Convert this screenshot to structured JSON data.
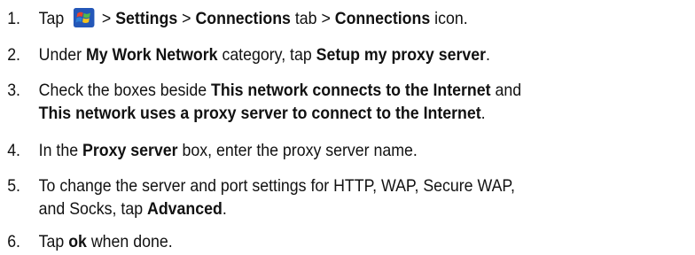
{
  "steps": [
    {
      "num": "1.",
      "tap": "Tap ",
      "gt1": " > ",
      "settings": "Settings",
      "gt2": " > ",
      "connections_tab": "Connections",
      "tab_word": " tab > ",
      "connections_icon": "Connections",
      "icon_word": " icon."
    },
    {
      "num": "2.",
      "under": "Under ",
      "network": "My Work Network",
      "category": " category, tap ",
      "setup": "Setup my proxy server",
      "end": "."
    },
    {
      "num": "3.",
      "check": "Check the boxes beside ",
      "connects": "This network connects to the Internet",
      "and": " and",
      "uses": "This network uses a proxy server to connect to the Internet",
      "end": "."
    },
    {
      "num": "4.",
      "in": "In the ",
      "proxy": "Proxy server",
      "rest": " box, enter the proxy server name."
    },
    {
      "num": "5.",
      "line1": "To change the server and port settings for HTTP, WAP, Secure WAP,",
      "line2a": "and Socks, tap ",
      "advanced": "Advanced",
      "end": "."
    },
    {
      "num": "6.",
      "tap": "Tap ",
      "ok": "ok",
      "rest": " when done."
    }
  ],
  "icons": {
    "start": "windows-start-flag-icon"
  },
  "colors": {
    "text": "#111111",
    "flag_red": "#e8432b",
    "flag_green": "#56b947",
    "flag_blue": "#2c7fd6",
    "flag_yellow": "#f5c21b",
    "tile_blue": "#2457b8"
  }
}
